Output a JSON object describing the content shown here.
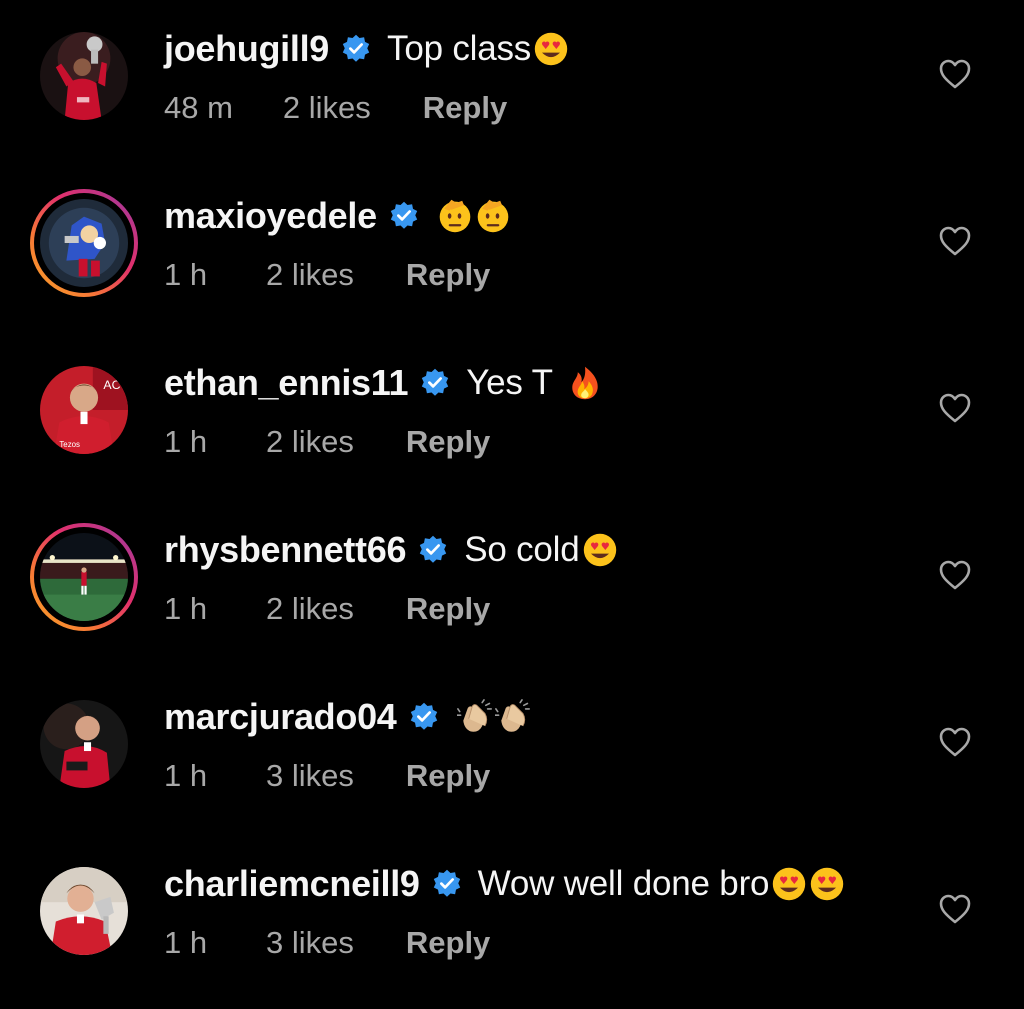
{
  "comments": [
    {
      "username": "joehugill9",
      "text": "Top class",
      "emojis": [
        "heart-eyes"
      ],
      "time": "48 m",
      "likes": "2 likes",
      "reply": "Reply",
      "story_ring": false,
      "avatar_theme": "trophy-celebration"
    },
    {
      "username": "maxioyedele",
      "text": "",
      "emojis": [
        "saluting-face",
        "saluting-face"
      ],
      "time": "1 h",
      "likes": "2 likes",
      "reply": "Reply",
      "story_ring": true,
      "avatar_theme": "cartoon-hedgehog"
    },
    {
      "username": "ethan_ennis11",
      "text": "Yes T",
      "emojis": [
        "fire"
      ],
      "time": "1 h",
      "likes": "2 likes",
      "reply": "Reply",
      "story_ring": false,
      "avatar_theme": "player-portrait"
    },
    {
      "username": "rhysbennett66",
      "text": "So cold",
      "emojis": [
        "heart-eyes"
      ],
      "time": "1 h",
      "likes": "2 likes",
      "reply": "Reply",
      "story_ring": true,
      "avatar_theme": "stadium-pitch"
    },
    {
      "username": "marcjurado04",
      "text": "",
      "emojis": [
        "clapping-hands",
        "clapping-hands"
      ],
      "time": "1 h",
      "likes": "3 likes",
      "reply": "Reply",
      "story_ring": false,
      "avatar_theme": "player-portrait"
    },
    {
      "username": "charliemcneill9",
      "text": "Wow well done bro",
      "emojis": [
        "heart-eyes",
        "heart-eyes"
      ],
      "time": "1 h",
      "likes": "3 likes",
      "reply": "Reply",
      "story_ring": false,
      "avatar_theme": "player-with-trophy"
    }
  ],
  "colors": {
    "background": "#000000",
    "primary_text": "#f5f5f5",
    "secondary_text": "#a8a8a8",
    "verified_badge": "#3897f0",
    "club_red": "#c8102e"
  }
}
